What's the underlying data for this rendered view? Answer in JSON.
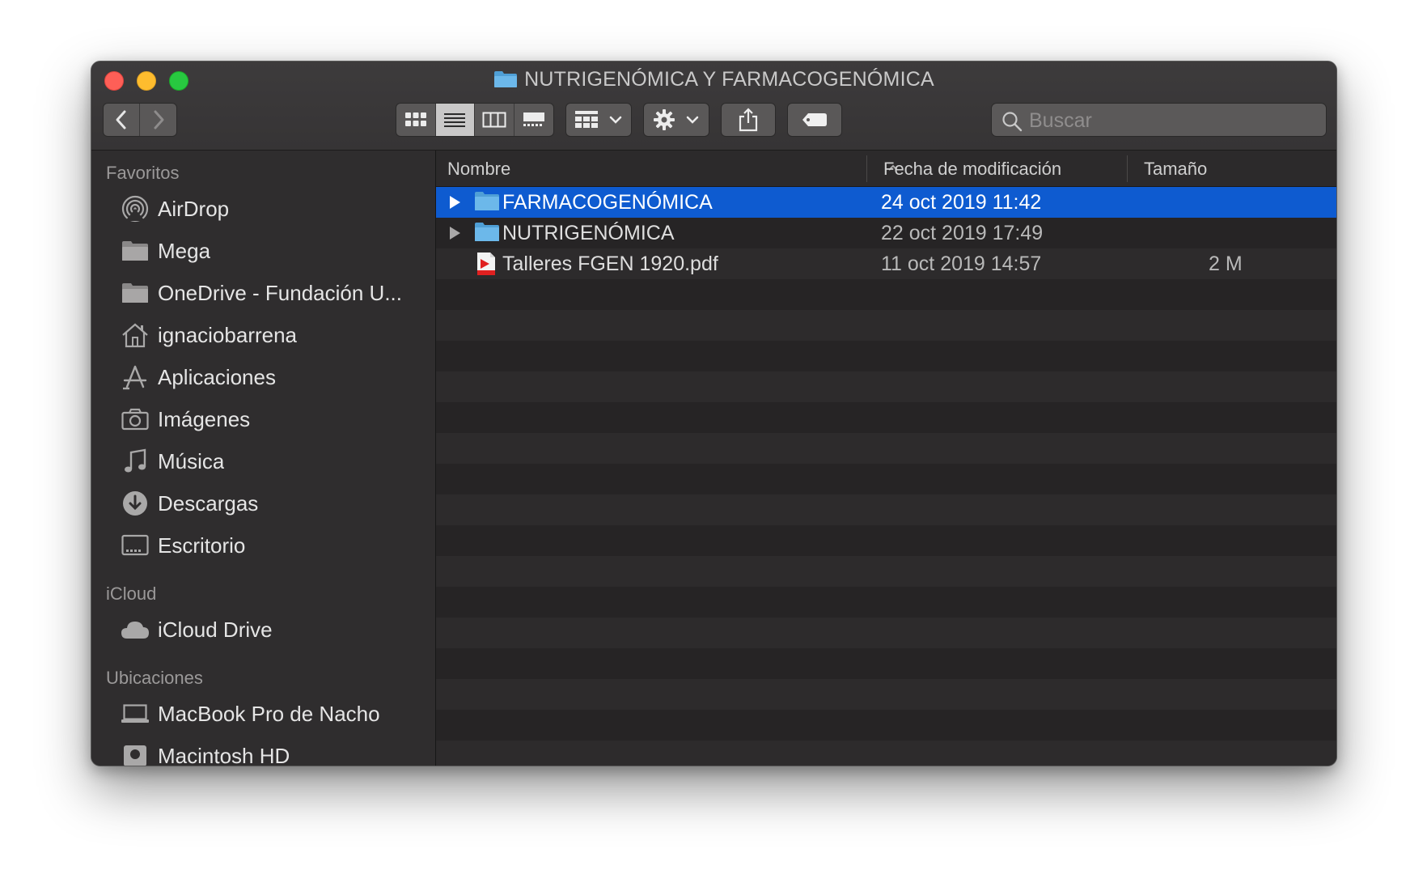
{
  "window": {
    "title": "NUTRIGENÓMICA Y FARMACOGENÓMICA"
  },
  "toolbar": {
    "back": "back",
    "forward": "forward",
    "view_modes": [
      "icon-view",
      "list-view",
      "column-view",
      "gallery-view"
    ],
    "active_view": "list-view",
    "search": {
      "placeholder": "Buscar",
      "value": ""
    }
  },
  "sidebar": {
    "sections": [
      {
        "title": "Favoritos",
        "items": [
          {
            "label": "AirDrop",
            "icon": "airdrop-icon"
          },
          {
            "label": "Mega",
            "icon": "folder-icon"
          },
          {
            "label": "OneDrive - Fundación U...",
            "icon": "folder-icon"
          },
          {
            "label": "ignaciobarrena",
            "icon": "home-icon"
          },
          {
            "label": "Aplicaciones",
            "icon": "applications-icon"
          },
          {
            "label": "Imágenes",
            "icon": "camera-icon"
          },
          {
            "label": "Música",
            "icon": "music-note-icon"
          },
          {
            "label": "Descargas",
            "icon": "download-icon"
          },
          {
            "label": "Escritorio",
            "icon": "desktop-icon"
          }
        ]
      },
      {
        "title": "iCloud",
        "items": [
          {
            "label": "iCloud Drive",
            "icon": "cloud-icon"
          }
        ]
      },
      {
        "title": "Ubicaciones",
        "items": [
          {
            "label": "MacBook Pro de Nacho",
            "icon": "laptop-icon"
          },
          {
            "label": "Macintosh HD",
            "icon": "hard-drive-icon"
          }
        ]
      }
    ]
  },
  "list": {
    "columns": {
      "name": "Nombre",
      "date": "Fecha de modificación",
      "size": "Tamaño"
    },
    "files": [
      {
        "name": "FARMACOGENÓMICA",
        "date": "24 oct 2019 11:42",
        "size": "",
        "kind": "folder",
        "selected": true
      },
      {
        "name": "NUTRIGENÓMICA",
        "date": "22 oct 2019 17:49",
        "size": "",
        "kind": "folder",
        "selected": false
      },
      {
        "name": "Talleres FGEN 1920.pdf",
        "date": "11 oct 2019 14:57",
        "size": "2 M",
        "kind": "pdf",
        "selected": false
      }
    ]
  },
  "colors": {
    "selection": "#0e5bd0",
    "folder": "#5aa9e0",
    "accent_pdf": "#e02020"
  }
}
